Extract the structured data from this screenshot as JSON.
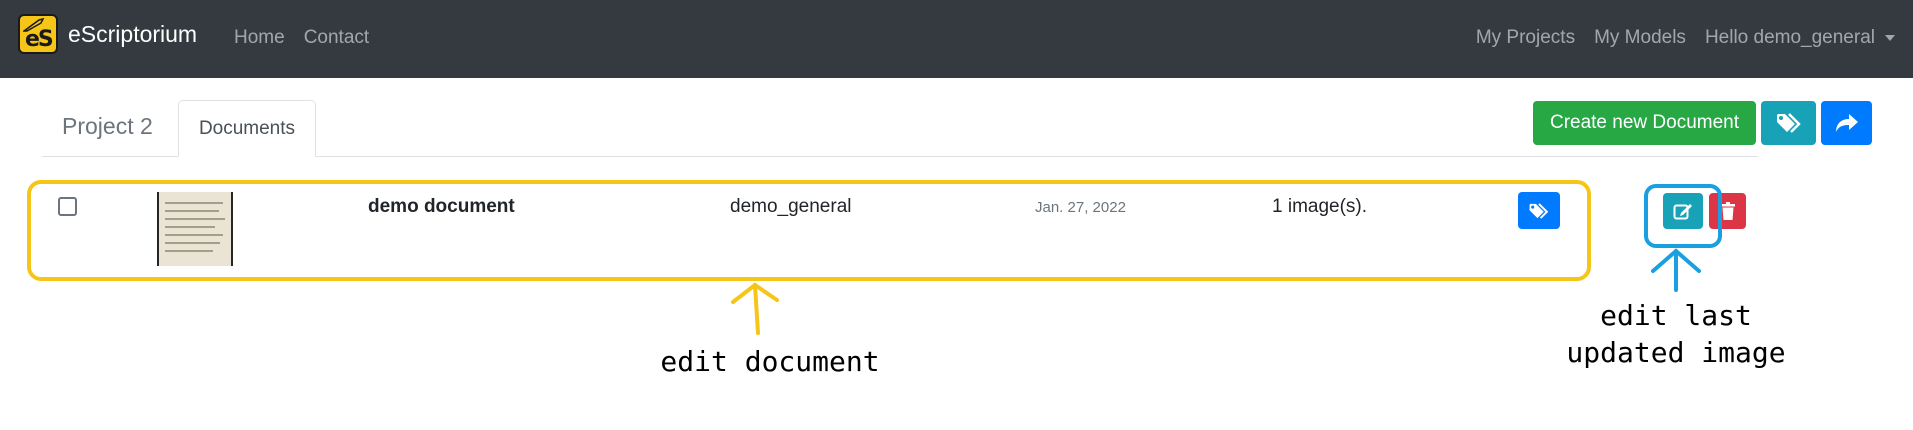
{
  "navbar": {
    "brand": "eScriptorium",
    "logo_text": "eS",
    "links": [
      "Home",
      "Contact"
    ],
    "right_links": [
      "My Projects",
      "My Models"
    ],
    "user_menu": "Hello demo_general"
  },
  "tabs": {
    "project": "Project 2",
    "documents": "Documents"
  },
  "toolbar": {
    "create_label": "Create new Document",
    "tag_icon": "tags-icon",
    "share_icon": "share-icon"
  },
  "document": {
    "name": "demo document",
    "owner": "demo_general",
    "date": "Jan. 27, 2022",
    "images": "1 image(s)."
  },
  "annotations": {
    "edit_document": "edit document",
    "edit_last_line1": "edit last",
    "edit_last_line2": "updated image"
  },
  "colors": {
    "navbar": "#343a40",
    "success": "#28a745",
    "info": "#17a2b8",
    "primary": "#007bff",
    "danger": "#dc3545",
    "highlight_yellow": "#f5c518",
    "highlight_blue": "#1aa0e0"
  }
}
